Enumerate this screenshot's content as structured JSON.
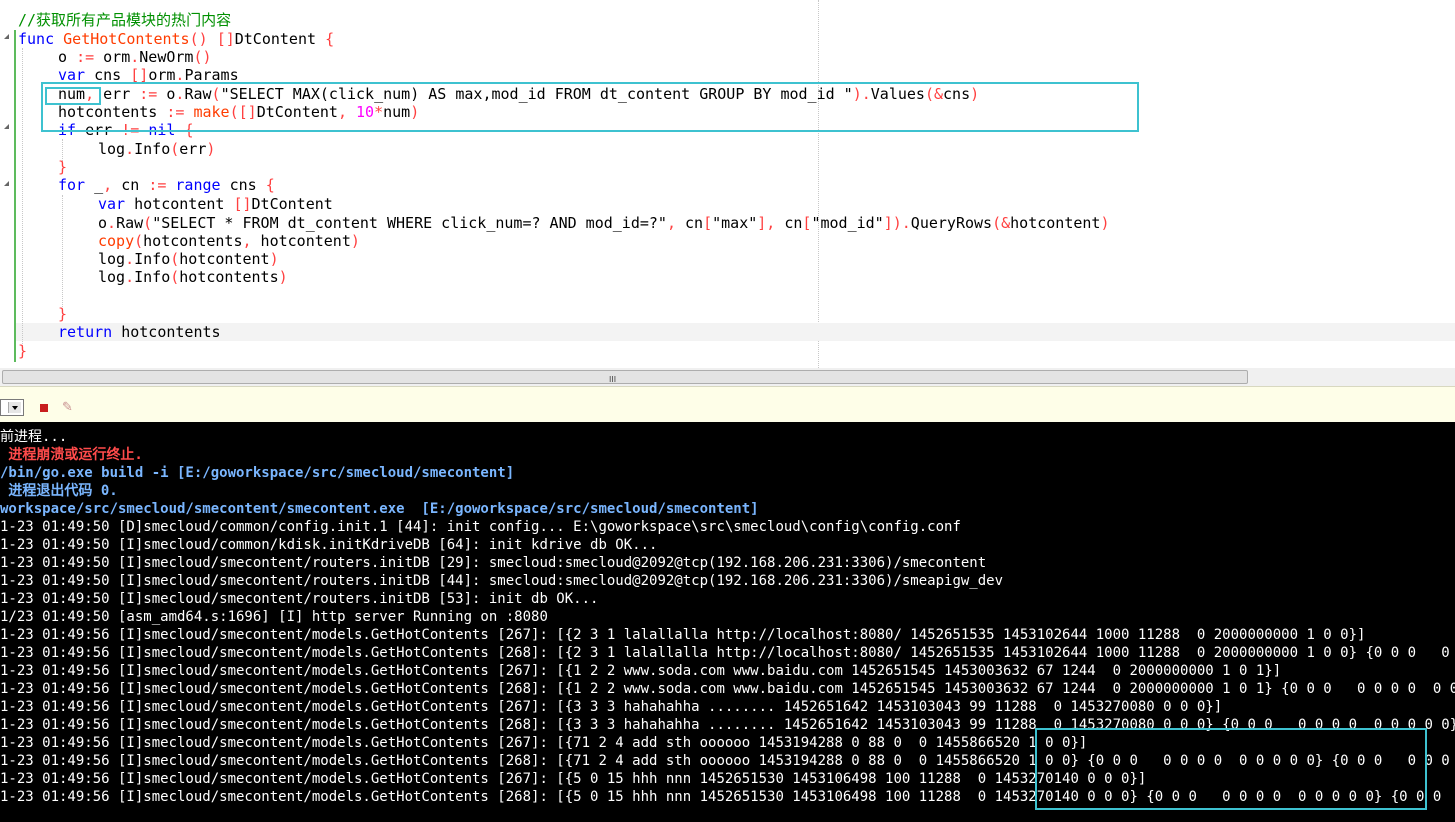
{
  "editor": {
    "comment": "//获取所有产品模块的热门内容",
    "lines": [
      {
        "parts": [
          [
            "kw",
            "func "
          ],
          [
            "fn",
            "GetHotContents"
          ],
          [
            "op",
            "()"
          ],
          [
            "",
            " "
          ],
          [
            "op",
            "[]"
          ],
          [
            "",
            "DtContent "
          ],
          [
            "op",
            "{"
          ]
        ]
      },
      {
        "parts": [
          [
            "",
            "o "
          ],
          [
            "op",
            ":="
          ],
          [
            "",
            " orm"
          ],
          [
            "op",
            "."
          ],
          [
            "",
            "NewOrm"
          ],
          [
            "op",
            "()"
          ]
        ]
      },
      {
        "parts": [
          [
            "kw",
            "var"
          ],
          [
            "",
            " cns "
          ],
          [
            "op",
            "[]"
          ],
          [
            "",
            "orm"
          ],
          [
            "op",
            "."
          ],
          [
            "",
            "Params"
          ]
        ]
      },
      {
        "parts": [
          [
            "",
            "num"
          ],
          [
            "op",
            ","
          ],
          [
            "",
            " err "
          ],
          [
            "op",
            ":="
          ],
          [
            "",
            " o"
          ],
          [
            "op",
            "."
          ],
          [
            "",
            "Raw"
          ],
          [
            "op",
            "("
          ],
          [
            "",
            "\"SELECT MAX(click_num) AS max,mod_id FROM dt_content GROUP BY mod_id \""
          ],
          [
            "op",
            ")."
          ],
          [
            "",
            "Values"
          ],
          [
            "op",
            "("
          ],
          [
            "op",
            "&"
          ],
          [
            "",
            "cns"
          ],
          [
            "op",
            ")"
          ]
        ]
      },
      {
        "parts": [
          [
            "",
            "hotcontents "
          ],
          [
            "op",
            ":="
          ],
          [
            "",
            " "
          ],
          [
            "fn",
            "make"
          ],
          [
            "op",
            "([]"
          ],
          [
            "",
            "DtContent"
          ],
          [
            "op",
            ","
          ],
          [
            "",
            " "
          ],
          [
            "num",
            "10"
          ],
          [
            "op",
            "*"
          ],
          [
            "",
            "num"
          ],
          [
            "op",
            ")"
          ]
        ]
      },
      {
        "parts": [
          [
            "kw",
            "if"
          ],
          [
            "",
            " err "
          ],
          [
            "op",
            "!="
          ],
          [
            "",
            " "
          ],
          [
            "kw",
            "nil"
          ],
          [
            "",
            " "
          ],
          [
            "op",
            "{"
          ]
        ]
      },
      {
        "parts": [
          [
            "",
            "log"
          ],
          [
            "op",
            "."
          ],
          [
            "",
            "Info"
          ],
          [
            "op",
            "("
          ],
          [
            "",
            "err"
          ],
          [
            "op",
            ")"
          ]
        ]
      },
      {
        "parts": [
          [
            "op",
            "}"
          ]
        ]
      },
      {
        "parts": [
          [
            "kw",
            "for"
          ],
          [
            "",
            " _"
          ],
          [
            "op",
            ","
          ],
          [
            "",
            " cn "
          ],
          [
            "op",
            ":="
          ],
          [
            "",
            " "
          ],
          [
            "kw",
            "range"
          ],
          [
            "",
            " cns "
          ],
          [
            "op",
            "{"
          ]
        ]
      },
      {
        "parts": [
          [
            "kw",
            "var"
          ],
          [
            "",
            " hotcontent "
          ],
          [
            "op",
            "[]"
          ],
          [
            "",
            "DtContent"
          ]
        ]
      },
      {
        "parts": [
          [
            "",
            "o"
          ],
          [
            "op",
            "."
          ],
          [
            "",
            "Raw"
          ],
          [
            "op",
            "("
          ],
          [
            "",
            "\"SELECT * FROM dt_content WHERE click_num=? AND mod_id=?\""
          ],
          [
            "op",
            ","
          ],
          [
            "",
            " cn"
          ],
          [
            "op",
            "["
          ],
          [
            "",
            "\"max\""
          ],
          [
            "op",
            "],"
          ],
          [
            "",
            " cn"
          ],
          [
            "op",
            "["
          ],
          [
            "",
            "\"mod_id\""
          ],
          [
            "op",
            "])."
          ],
          [
            "",
            "QueryRows"
          ],
          [
            "op",
            "("
          ],
          [
            "op",
            "&"
          ],
          [
            "",
            "hotcontent"
          ],
          [
            "op",
            ")"
          ]
        ]
      },
      {
        "parts": [
          [
            "fn",
            "copy"
          ],
          [
            "op",
            "("
          ],
          [
            "",
            "hotcontents"
          ],
          [
            "op",
            ","
          ],
          [
            "",
            " hotcontent"
          ],
          [
            "op",
            ")"
          ]
        ]
      },
      {
        "parts": [
          [
            "",
            "log"
          ],
          [
            "op",
            "."
          ],
          [
            "",
            "Info"
          ],
          [
            "op",
            "("
          ],
          [
            "",
            "hotcontent"
          ],
          [
            "op",
            ")"
          ]
        ]
      },
      {
        "parts": [
          [
            "",
            "log"
          ],
          [
            "op",
            "."
          ],
          [
            "",
            "Info"
          ],
          [
            "op",
            "("
          ],
          [
            "",
            "hotcontents"
          ],
          [
            "op",
            ")"
          ]
        ]
      },
      {
        "parts": []
      },
      {
        "parts": [
          [
            "op",
            "}"
          ]
        ]
      },
      {
        "parts": [
          [
            "kw",
            "return"
          ],
          [
            "",
            " hotcontents"
          ]
        ]
      },
      {
        "parts": [
          [
            "op",
            "}"
          ]
        ]
      }
    ]
  },
  "scrollbar": {
    "grip": "III"
  },
  "console": {
    "lines": [
      {
        "style": "normal",
        "text": "前进程..."
      },
      {
        "style": "red",
        "text": " 进程崩溃或运行终止."
      },
      {
        "style": "blue",
        "text": "/bin/go.exe build -i [E:/goworkspace/src/smecloud/smecontent]"
      },
      {
        "style": "blue",
        "text": " 进程退出代码 0."
      },
      {
        "style": "blue",
        "text": "workspace/src/smecloud/smecontent/smecontent.exe  [E:/goworkspace/src/smecloud/smecontent]"
      },
      {
        "style": "normal",
        "text": "1-23 01:49:50 [D]smecloud/common/config.init.1 [44]: init config... E:\\goworkspace\\src\\smecloud\\config\\config.conf"
      },
      {
        "style": "normal",
        "text": "1-23 01:49:50 [I]smecloud/common/kdisk.initKdriveDB [64]: init kdrive db OK..."
      },
      {
        "style": "normal",
        "text": "1-23 01:49:50 [I]smecloud/smecontent/routers.initDB [29]: smecloud:smecloud@2092@tcp(192.168.206.231:3306)/smecontent"
      },
      {
        "style": "normal",
        "text": "1-23 01:49:50 [I]smecloud/smecontent/routers.initDB [44]: smecloud:smecloud@2092@tcp(192.168.206.231:3306)/smeapigw_dev"
      },
      {
        "style": "normal",
        "text": "1-23 01:49:50 [I]smecloud/smecontent/routers.initDB [53]: init db OK..."
      },
      {
        "style": "normal",
        "text": "1/23 01:49:50 [asm_amd64.s:1696] [I] http server Running on :8080"
      },
      {
        "style": "normal",
        "text": "1-23 01:49:56 [I]smecloud/smecontent/models.GetHotContents [267]: [{2 3 1 lalallalla http://localhost:8080/ 1452651535 1453102644 1000 11288  0 2000000000 1 0 0}]"
      },
      {
        "style": "normal",
        "text": "1-23 01:49:56 [I]smecloud/smecontent/models.GetHotContents [268]: [{2 3 1 lalallalla http://localhost:8080/ 1452651535 1453102644 1000 11288  0 2000000000 1 0 0} {0 0 0   0 0 0 0  0"
      },
      {
        "style": "normal",
        "text": "1-23 01:49:56 [I]smecloud/smecontent/models.GetHotContents [267]: [{1 2 2 www.soda.com www.baidu.com 1452651545 1453003632 67 1244  0 2000000000 1 0 1}]"
      },
      {
        "style": "normal",
        "text": "1-23 01:49:56 [I]smecloud/smecontent/models.GetHotContents [268]: [{1 2 2 www.soda.com www.baidu.com 1452651545 1453003632 67 1244  0 2000000000 1 0 1} {0 0 0   0 0 0 0  0 0 0 0 0} {"
      },
      {
        "style": "normal",
        "text": "1-23 01:49:56 [I]smecloud/smecontent/models.GetHotContents [267]: [{3 3 3 hahahahha ........ 1452651642 1453103043 99 11288  0 1453270080 0 0 0}]"
      },
      {
        "style": "normal",
        "text": "1-23 01:49:56 [I]smecloud/smecontent/models.GetHotContents [268]: [{3 3 3 hahahahha ........ 1452651642 1453103043 99 11288  0 1453270080 0 0 0} {0 0 0   0 0 0 0  0 0 0 0 0} {0 0 0"
      },
      {
        "style": "normal",
        "text": "1-23 01:49:56 [I]smecloud/smecontent/models.GetHotContents [267]: [{71 2 4 add sth oooooo 1453194288 0 88 0  0 1455866520 1 0 0}]"
      },
      {
        "style": "normal",
        "text": "1-23 01:49:56 [I]smecloud/smecontent/models.GetHotContents [268]: [{71 2 4 add sth oooooo 1453194288 0 88 0  0 1455866520 1 0 0} {0 0 0   0 0 0 0  0 0 0 0 0} {0 0 0   0 0 0 0  0 0 0"
      },
      {
        "style": "normal",
        "text": "1-23 01:49:56 [I]smecloud/smecontent/models.GetHotContents [267]: [{5 0 15 hhh nnn 1452651530 1453106498 100 11288  0 1453270140 0 0 0}]"
      },
      {
        "style": "normal",
        "text": "1-23 01:49:56 [I]smecloud/smecontent/models.GetHotContents [268]: [{5 0 15 hhh nnn 1452651530 1453106498 100 11288  0 1453270140 0 0 0} {0 0 0   0 0 0 0  0 0 0 0 0} {0 0 0   0 0 0"
      }
    ]
  }
}
